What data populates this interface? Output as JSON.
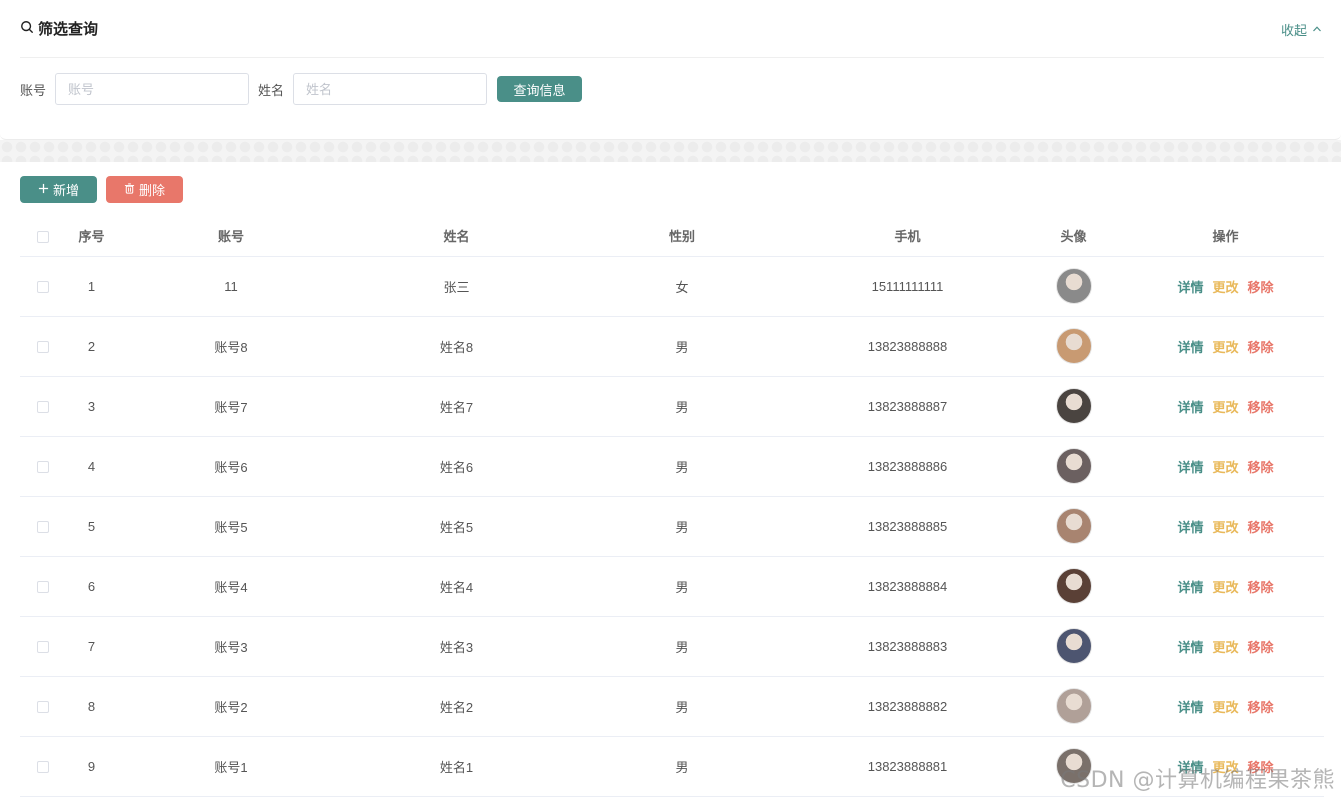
{
  "filter": {
    "title": "筛选查询",
    "collapse_label": "收起",
    "account_label": "账号",
    "account_placeholder": "账号",
    "account_value": "",
    "name_label": "姓名",
    "name_placeholder": "姓名",
    "name_value": "",
    "query_label": "查询信息"
  },
  "toolbar": {
    "add_label": "新增",
    "delete_label": "删除"
  },
  "table": {
    "headers": {
      "index": "序号",
      "account": "账号",
      "name": "姓名",
      "gender": "性别",
      "phone": "手机",
      "avatar": "头像",
      "actions": "操作"
    },
    "action_labels": {
      "detail": "详情",
      "edit": "更改",
      "remove": "移除"
    },
    "rows": [
      {
        "index": "1",
        "account": "11",
        "name": "张三",
        "gender": "女",
        "phone": "15111111111",
        "avatar_color": "#8a8a8a"
      },
      {
        "index": "2",
        "account": "账号8",
        "name": "姓名8",
        "gender": "男",
        "phone": "13823888888",
        "avatar_color": "#c89a72"
      },
      {
        "index": "3",
        "account": "账号7",
        "name": "姓名7",
        "gender": "男",
        "phone": "13823888887",
        "avatar_color": "#4a4440"
      },
      {
        "index": "4",
        "account": "账号6",
        "name": "姓名6",
        "gender": "男",
        "phone": "13823888886",
        "avatar_color": "#6b6060"
      },
      {
        "index": "5",
        "account": "账号5",
        "name": "姓名5",
        "gender": "男",
        "phone": "13823888885",
        "avatar_color": "#a88470"
      },
      {
        "index": "6",
        "account": "账号4",
        "name": "姓名4",
        "gender": "男",
        "phone": "13823888884",
        "avatar_color": "#5a4036"
      },
      {
        "index": "7",
        "account": "账号3",
        "name": "姓名3",
        "gender": "男",
        "phone": "13823888883",
        "avatar_color": "#4d5570"
      },
      {
        "index": "8",
        "account": "账号2",
        "name": "姓名2",
        "gender": "男",
        "phone": "13823888882",
        "avatar_color": "#b0a098"
      },
      {
        "index": "9",
        "account": "账号1",
        "name": "姓名1",
        "gender": "男",
        "phone": "13823888881",
        "avatar_color": "#7a706a"
      }
    ]
  },
  "watermark": "CSDN @计算机编程果茶熊",
  "colors": {
    "primary": "#4a8f88",
    "danger": "#e8776a",
    "warning": "#e9b95b"
  },
  "icons": {
    "search": "search-icon",
    "collapse": "chevron-up-icon",
    "add": "plus-icon",
    "delete": "trash-icon"
  }
}
